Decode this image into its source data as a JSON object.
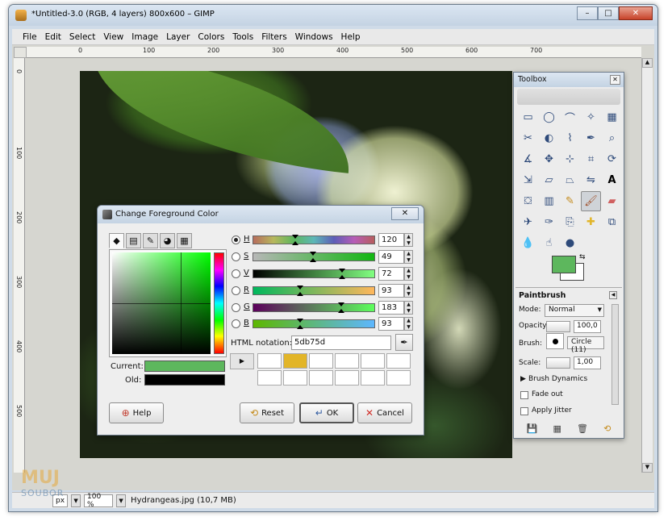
{
  "window": {
    "title": "*Untitled-3.0 (RGB, 4 layers) 800x600 – GIMP",
    "min_label": "–",
    "max_label": "□",
    "close_label": "✕"
  },
  "menu": [
    "File",
    "Edit",
    "Select",
    "View",
    "Image",
    "Layer",
    "Colors",
    "Tools",
    "Filters",
    "Windows",
    "Help"
  ],
  "ruler": {
    "h_ticks": [
      "0",
      "100",
      "200",
      "300",
      "400",
      "500",
      "600",
      "700"
    ],
    "v_ticks": [
      "0",
      "100",
      "200",
      "300",
      "400",
      "500"
    ]
  },
  "statusbar": {
    "unit": "px",
    "zoom": "100 %",
    "file_info": "Hydrangeas.jpg (10,7 MB)"
  },
  "dialog": {
    "title": "Change Foreground Color",
    "close_label": "✕",
    "current_label": "Current:",
    "old_label": "Old:",
    "current_color": "#5db75d",
    "old_color": "#000000",
    "html_label": "HTML notation:",
    "html_value": "5db75d",
    "sliders": [
      {
        "label": "H",
        "value": "120",
        "selected": true
      },
      {
        "label": "S",
        "value": "49",
        "selected": false
      },
      {
        "label": "V",
        "value": "72",
        "selected": false
      },
      {
        "label": "R",
        "value": "93",
        "selected": false
      },
      {
        "label": "G",
        "value": "183",
        "selected": false
      },
      {
        "label": "B",
        "value": "93",
        "selected": false
      }
    ],
    "history_colors": [
      "#ffffff",
      "#e2b528",
      "#ffffff",
      "#ffffff",
      "#ffffff",
      "#ffffff",
      "#ffffff",
      "#ffffff",
      "#ffffff",
      "#ffffff",
      "#ffffff",
      "#ffffff"
    ],
    "help_label": "Help",
    "reset_label": "Reset",
    "ok_label": "OK",
    "cancel_label": "Cancel"
  },
  "toolbox": {
    "title": "Toolbox",
    "close_label": "✕",
    "fg_color": "#5db75d",
    "bg_color": "#ffffff",
    "options_title": "Paintbrush",
    "mode_label": "Mode:",
    "mode_value": "Normal",
    "opacity_label": "Opacity:",
    "opacity_value": "100,0",
    "brush_label": "Brush:",
    "brush_value": "Circle (11)",
    "scale_label": "Scale:",
    "scale_value": "1,00",
    "dynamics_label": "Brush Dynamics",
    "fade_label": "Fade out",
    "jitter_label": "Apply Jitter"
  },
  "watermark": {
    "top": "MUJ",
    "bottom": "SOUBOR"
  }
}
